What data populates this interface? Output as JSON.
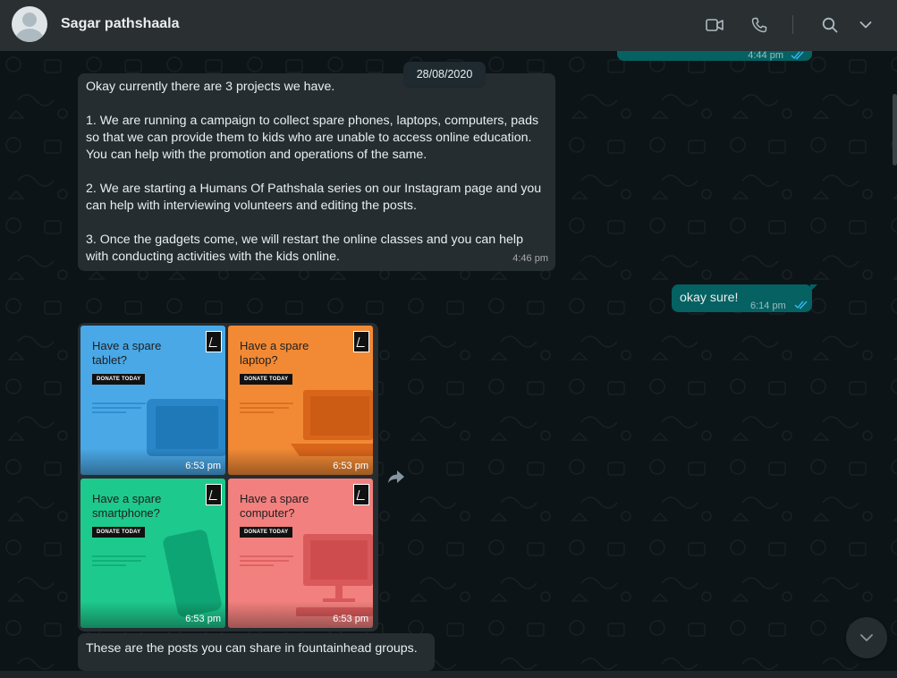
{
  "header": {
    "contact_name": "Sagar pathshaala",
    "icons": [
      "avatar",
      "video-call-icon",
      "voice-call-icon",
      "search-icon",
      "chevron-down-icon"
    ]
  },
  "date_chip": "28/08/2020",
  "messages": {
    "top_out": {
      "time": "4:44 pm",
      "status": "read"
    },
    "msg1": {
      "lines": [
        "Okay currently there are 3 projects we have.",
        "1. We are running a campaign to collect spare phones, laptops, computers, pads so that we can provide them to kids who are unable to access online education. You can help with the promotion and operations of the same.",
        "2. We are starting a Humans Of Pathshala series on our Instagram page and you can help with interviewing volunteers and editing the posts.",
        "3. Once the gadgets come, we will restart the online classes and you can help with conducting activities with the kids online."
      ],
      "time": "4:46 pm"
    },
    "msg2": {
      "text": "okay sure!",
      "time": "6:14 pm",
      "status": "read"
    },
    "images": [
      {
        "title": "Have a spare tablet?",
        "badge": "DONATE TODAY",
        "time": "6:53 pm",
        "bg": "#4aa8e6",
        "device": "#2a86c8"
      },
      {
        "title": "Have a spare laptop?",
        "badge": "DONATE TODAY",
        "time": "6:53 pm",
        "bg": "#f28a35",
        "device": "#d8651a"
      },
      {
        "title": "Have a spare smartphone?",
        "badge": "DONATE TODAY",
        "time": "6:53 pm",
        "bg": "#1ec98e",
        "device": "#0ea574"
      },
      {
        "title": "Have a spare computer?",
        "badge": "DONATE TODAY",
        "time": "6:53 pm",
        "bg": "#f2807e",
        "device": "#d9595a"
      }
    ],
    "msg3": {
      "text": "These are the posts you can share in fountainhead groups."
    }
  },
  "colors": {
    "header_bg": "#2a2f32",
    "chat_bg": "#0d1418",
    "incoming_bubble": "#262d31",
    "outgoing_bubble": "#056162",
    "read_tick": "#34b7f1"
  }
}
